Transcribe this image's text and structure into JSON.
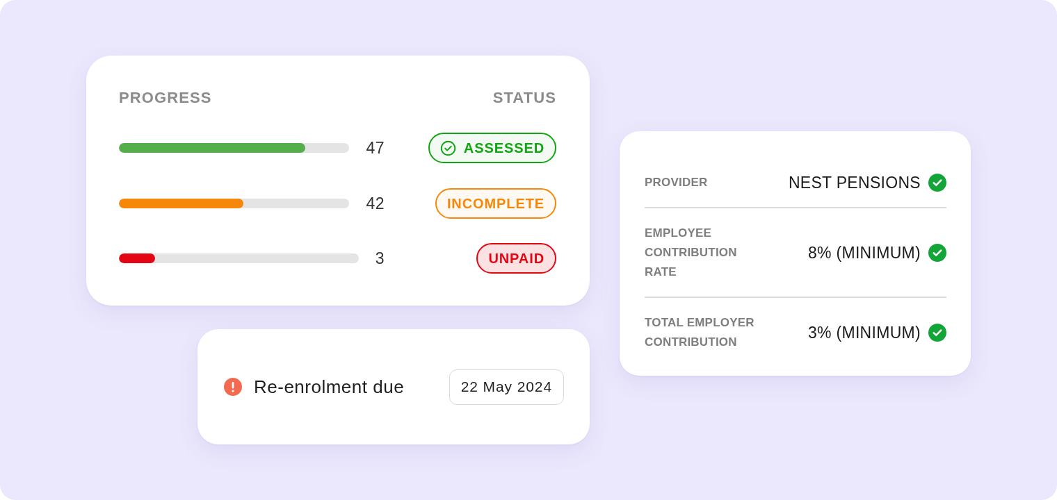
{
  "progress": {
    "heading": "PROGRESS",
    "status_heading": "STATUS",
    "rows": [
      {
        "level": 0.81,
        "count": "47",
        "color": "#55ae4a",
        "status": {
          "label": "ASSESSED",
          "kind": "assessed",
          "color": "#11a511"
        }
      },
      {
        "level": 0.54,
        "count": "42",
        "color": "#f5870a",
        "status": {
          "label": "INCOMPLETE",
          "kind": "incomplete",
          "color": "#f5870a"
        }
      },
      {
        "level": 0.15,
        "count": "3",
        "color": "#e30613",
        "status": {
          "label": "UNPAID",
          "kind": "unpaid",
          "color": "#e30613"
        }
      }
    ]
  },
  "reminder": {
    "text": "Re-enrolment due",
    "date": "22 May 2024"
  },
  "details": {
    "rows": [
      {
        "label": "PROVIDER",
        "value": "NEST PENSIONS",
        "verified": true
      },
      {
        "label": "EMPLOYEE CONTRIBUTION RATE",
        "value": "8% (MINIMUM)",
        "verified": true
      },
      {
        "label": "TOTAL EMPLOYER CONTRIBUTION",
        "value": "3% (MINIMUM)",
        "verified": true
      }
    ]
  }
}
